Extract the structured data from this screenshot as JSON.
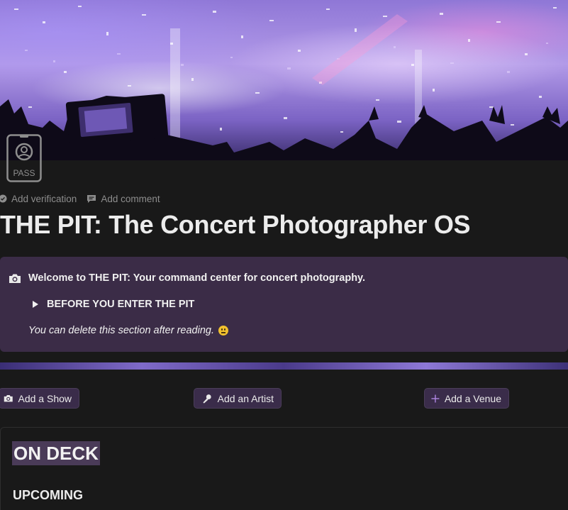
{
  "cover": {
    "description_icon": "concert-confetti-image"
  },
  "page_icon": {
    "label": "PASS",
    "icon": "pass-badge-icon"
  },
  "meta": {
    "add_verification": "Add verification",
    "add_comment": "Add comment"
  },
  "page_title": "THE PIT: The Concert Photographer OS",
  "callout": {
    "icon": "camera-icon",
    "headline": "Welcome to THE PIT: Your command center for concert photography.",
    "toggle_label": "BEFORE YOU ENTER THE PIT",
    "note": "You can delete this section after reading."
  },
  "buttons": {
    "add_show": "Add a Show",
    "add_artist": "Add an Artist",
    "add_venue": "Add a Venue"
  },
  "section": {
    "heading": "ON DECK",
    "subheading": "UPCOMING"
  },
  "colors": {
    "background": "#191919",
    "callout_bg": "#3b2c47",
    "button_bg": "#3a2c4a",
    "accent_purple": "#b48ae8"
  }
}
